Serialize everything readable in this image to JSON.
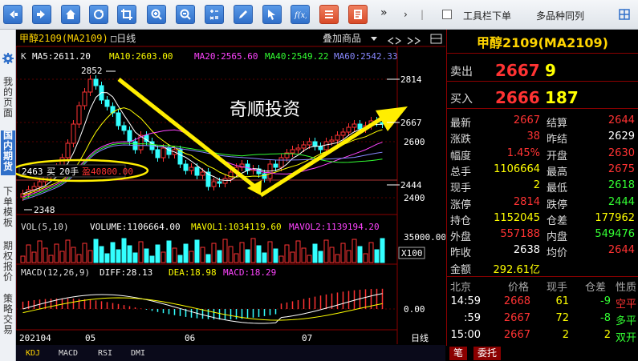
{
  "toolbar": {
    "more_label": "»",
    "toolbar_dropdown_label": "工具栏下单",
    "multi_period_label": "多品种同列"
  },
  "sidebar": {
    "tabs": [
      {
        "label": "我的页面"
      },
      {
        "label": "国内期货"
      },
      {
        "label": "下单模板"
      },
      {
        "label": "期权报价"
      },
      {
        "label": "策略交易"
      }
    ]
  },
  "chart": {
    "header_title": "甲醇2109(MA2109)",
    "period_label": "□日线",
    "overlay_label": "叠加商品",
    "ma_line": {
      "k": "K",
      "ma5": "MA5:2611.20",
      "ma10": "MA10:2603.00",
      "ma20": "MA20:2565.60",
      "ma40": "MA40:2549.22",
      "ma60": "MA60:2542.33"
    },
    "annotations": {
      "high": "2852",
      "low": "2348",
      "headline": "奇顺投资",
      "trade_price": "2463",
      "trade_side": "买",
      "trade_qty": "20手",
      "trade_profit": "盈40800.00"
    },
    "price_axis": [
      "2814",
      "2667",
      "2600",
      "2444",
      "2400"
    ],
    "vol_line": {
      "vol": "VOL(5,10)",
      "volume": "VOLUME:1106664.00",
      "mavol1": "MAVOL1:1034119.60",
      "mavol2": "MAVOL2:1139194.20"
    },
    "vol_axis": [
      "35000.00"
    ],
    "vol_unit": "X100",
    "macd_line": {
      "macd": "MACD(12,26,9)",
      "diff": "DIFF:28.13",
      "dea": "DEA:18.98",
      "macd_val": "MACD:18.29"
    },
    "macd_axis": [
      "0.00"
    ],
    "date_axis": [
      "202104",
      "05",
      "06",
      "07",
      "日线"
    ],
    "indicator_tabs": [
      "KDJ",
      "MACD",
      "RSI",
      "DMI"
    ]
  },
  "quote": {
    "title": "甲醇2109(MA2109)",
    "sell_label": "卖出",
    "sell_price": "2667",
    "sell_qty": "9",
    "buy_label": "买入",
    "buy_price": "2666",
    "buy_qty": "187",
    "stats": [
      {
        "l1": "最新",
        "v1": "2667",
        "c1": "#ff3333",
        "l2": "结算",
        "v2": "2644",
        "c2": "#ff3333"
      },
      {
        "l1": "涨跌",
        "v1": "38",
        "c1": "#ff3333",
        "l2": "昨结",
        "v2": "2629",
        "c2": "#ffffff"
      },
      {
        "l1": "幅度",
        "v1": "1.45%",
        "c1": "#ff3333",
        "l2": "开盘",
        "v2": "2630",
        "c2": "#ff3333"
      },
      {
        "l1": "总手",
        "v1": "1106664",
        "c1": "#ffff00",
        "l2": "最高",
        "v2": "2675",
        "c2": "#ff3333"
      },
      {
        "l1": "现手",
        "v1": "2",
        "c1": "#ffff00",
        "l2": "最低",
        "v2": "2618",
        "c2": "#33ff33"
      },
      {
        "l1": "涨停",
        "v1": "2814",
        "c1": "#ff3333",
        "l2": "跌停",
        "v2": "2444",
        "c2": "#33ff33"
      },
      {
        "l1": "持仓",
        "v1": "1152045",
        "c1": "#ffff00",
        "l2": "仓差",
        "v2": "177962",
        "c2": "#ffff00"
      },
      {
        "l1": "外盘",
        "v1": "557188",
        "c1": "#ff3333",
        "l2": "内盘",
        "v2": "549476",
        "c2": "#33ff33"
      },
      {
        "l1": "昨收",
        "v1": "2638",
        "c1": "#ffffff",
        "l2": "均价",
        "v2": "2644",
        "c2": "#ff3333"
      },
      {
        "l1": "金额",
        "v1": "292.61亿",
        "c1": "#ffff00",
        "l2": "",
        "v2": "",
        "c2": "#ffffff"
      }
    ],
    "ticks_header": [
      "北京",
      "价格",
      "现手",
      "仓差",
      "性质"
    ],
    "ticks": [
      {
        "time": "14:59",
        "price": "2668",
        "qty": "61",
        "diff": "-9",
        "nature": "空平",
        "nc": "#ff3333",
        "dc": "#33ff33"
      },
      {
        "time": ":59",
        "price": "2667",
        "qty": "72",
        "diff": "-8",
        "nature": "多平",
        "nc": "#33ff33",
        "dc": "#33ff33"
      },
      {
        "time": "15:00",
        "price": "2667",
        "qty": "2",
        "diff": "2",
        "nature": "双开",
        "nc": "#33ff33",
        "dc": "#ffff00"
      }
    ],
    "bottom_tabs": [
      "笔",
      "委托"
    ]
  },
  "colors": {
    "up": "#ff3333",
    "down": "#33ffff",
    "ma5": "#ffffff",
    "ma10": "#ffff00",
    "ma20": "#ff44ff",
    "ma40": "#33ff33",
    "ma60": "#8888ff",
    "arrow": "#ffee00"
  }
}
